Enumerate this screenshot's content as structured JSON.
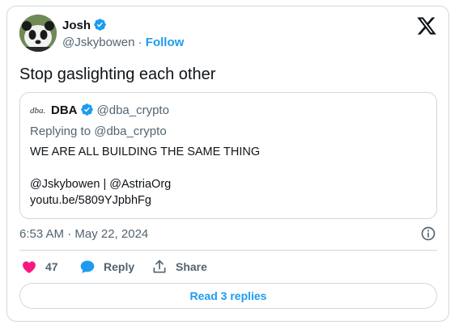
{
  "author": {
    "name": "Josh",
    "handle": "@Jskybowen",
    "separator": "·",
    "follow_label": "Follow"
  },
  "tweet": {
    "text": "Stop gaslighting each other",
    "timestamp": "6:53 AM · May 22, 2024"
  },
  "quote": {
    "avatar_text": "dba.",
    "name": "DBA",
    "handle": "@dba_crypto",
    "replying_to": "Replying to @dba_crypto",
    "lines": [
      "WE ARE ALL BUILDING THE SAME THING",
      "@Jskybowen | @AstriaOrg",
      "youtu.be/5809YJpbhFg"
    ]
  },
  "actions": {
    "like_count": "47",
    "reply_label": "Reply",
    "share_label": "Share",
    "read_replies_label": "Read 3 replies"
  },
  "colors": {
    "accent": "#1d9bf0",
    "like": "#f91880",
    "muted": "#536471",
    "border": "#cfd9de"
  }
}
